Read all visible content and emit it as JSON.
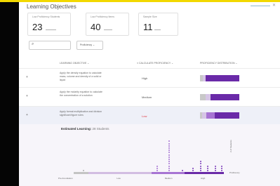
{
  "header": {
    "title": "Learning Objectives",
    "link": "▬▬▬▬▬▬▬",
    "close": "✕"
  },
  "cards": [
    {
      "label": "Low Proficiency Students",
      "value": "23",
      "sub": "▬▬▬▬▬"
    },
    {
      "label": "Low Proficiency Items",
      "value": "40",
      "sub": "▬▬▬▬"
    },
    {
      "label": "Sample Size",
      "value": "11",
      "sub": "▬▬▬"
    }
  ],
  "filter": {
    "label": "Proficiency  ⌄"
  },
  "table": {
    "headers": [
      "LEARNING OBJECTIVE ⌄",
      "≡ CALCULATE PROFICIENCY ⌄",
      "PROFICIENCY DISTRIBUTION ⌄"
    ],
    "rows": [
      {
        "expand": "+",
        "objective": "Apply the density equation to calculate mass, volume and density of a solid or liquid",
        "level": "High",
        "level_color": "#555555",
        "dist": [
          0.08,
          0.06,
          0.86
        ]
      },
      {
        "expand": "+",
        "objective": "Apply the molarity equation to calculate the concentration of a solution",
        "level": "Medium",
        "level_color": "#555555",
        "dist": [
          0.14,
          0.12,
          0.74
        ]
      },
      {
        "expand": "+",
        "objective": "Apply formal multiplication and division significant figure rules",
        "level": "Low",
        "level_color": "#e0363f",
        "dist": [
          0.06,
          0.1,
          0.22,
          0.62
        ]
      }
    ]
  },
  "chart": {
    "title": "Estimated Learning:",
    "subtitle": "28 Students",
    "ylabel": "# of Students",
    "legend": "Proficiency",
    "bands": [
      "Pre-Foundation",
      "Low",
      "Medium",
      "High"
    ],
    "band_colors": [
      "#c4c4c4",
      "#d2bde2",
      "#a774d3",
      "#6a2aa8"
    ],
    "columns": [
      {
        "pos": 0.06,
        "count": 1,
        "band": 0
      },
      {
        "pos": 0.55,
        "count": 3,
        "band": 2
      },
      {
        "pos": 0.63,
        "count": 14,
        "band": 2
      },
      {
        "pos": 0.72,
        "count": 1,
        "band": 3
      },
      {
        "pos": 0.79,
        "count": 2,
        "band": 3
      },
      {
        "pos": 0.84,
        "count": 5,
        "band": 3
      },
      {
        "pos": 0.89,
        "count": 3,
        "band": 3
      },
      {
        "pos": 0.94,
        "count": 3,
        "band": 3
      },
      {
        "pos": 0.98,
        "count": 3,
        "band": 3
      }
    ]
  }
}
